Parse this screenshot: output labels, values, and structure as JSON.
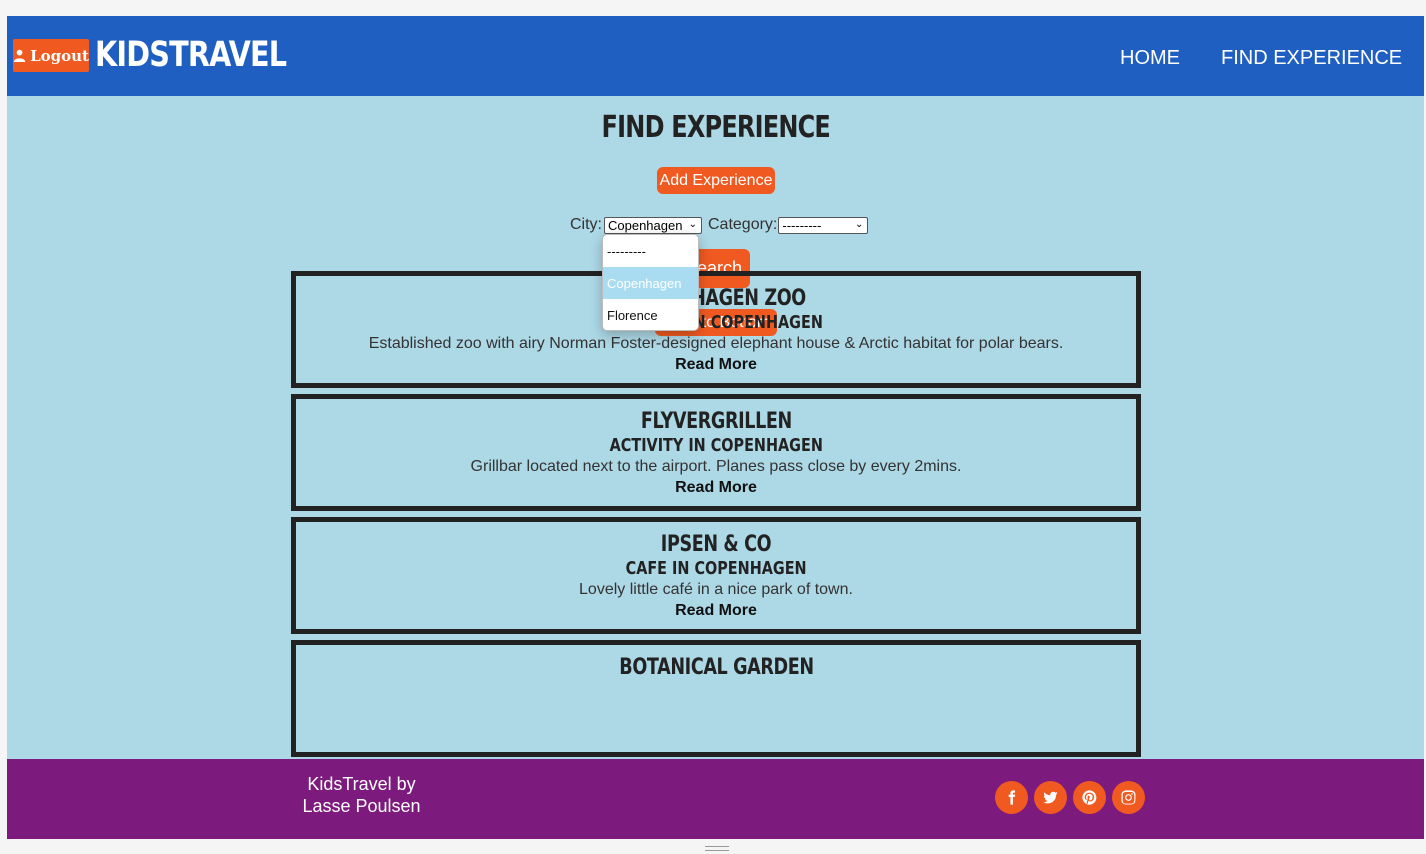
{
  "header": {
    "logout_label": "Logout",
    "brand": "KIDSTRAVEL",
    "nav": [
      {
        "label": "HOME"
      },
      {
        "label": "FIND EXPERIENCE"
      }
    ]
  },
  "main": {
    "title": "FIND EXPERIENCE",
    "add_experience_label": "Add Experience",
    "city_label": "City:",
    "city_selected": "Copenhagen",
    "category_label": "Category:",
    "category_selected": "---------",
    "search_label": "Search",
    "back_to_bottom_label": "Back to Bottom",
    "city_options": [
      "---------",
      "Copenhagen",
      "Florence"
    ]
  },
  "experiences": [
    {
      "title": "COPENHAGEN ZOO",
      "subtitle": "ACTIVITY IN COPENHAGEN",
      "description": "Established zoo with airy Norman Foster-designed elephant house & Arctic habitat for polar bears.",
      "read_more": "Read More"
    },
    {
      "title": "FLYVERGRILLEN",
      "subtitle": "ACTIVITY IN COPENHAGEN",
      "description": "Grillbar located next to the airport. Planes pass close by every 2mins.",
      "read_more": "Read More"
    },
    {
      "title": "IPSEN & CO",
      "subtitle": "CAFE IN COPENHAGEN",
      "description": "Lovely little café in a nice park of town.",
      "read_more": "Read More"
    },
    {
      "title": "BOTANICAL GARDEN",
      "subtitle": "",
      "description": "",
      "read_more": ""
    }
  ],
  "footer": {
    "line1": "KidsTravel by",
    "line2": "Lasse Poulsen",
    "social": [
      "facebook-icon",
      "twitter-icon",
      "pinterest-icon",
      "instagram-icon"
    ]
  },
  "colors": {
    "header": "#1f5fc1",
    "background": "#add8e6",
    "accent": "#f05a21",
    "footer": "#7d1a7d"
  }
}
